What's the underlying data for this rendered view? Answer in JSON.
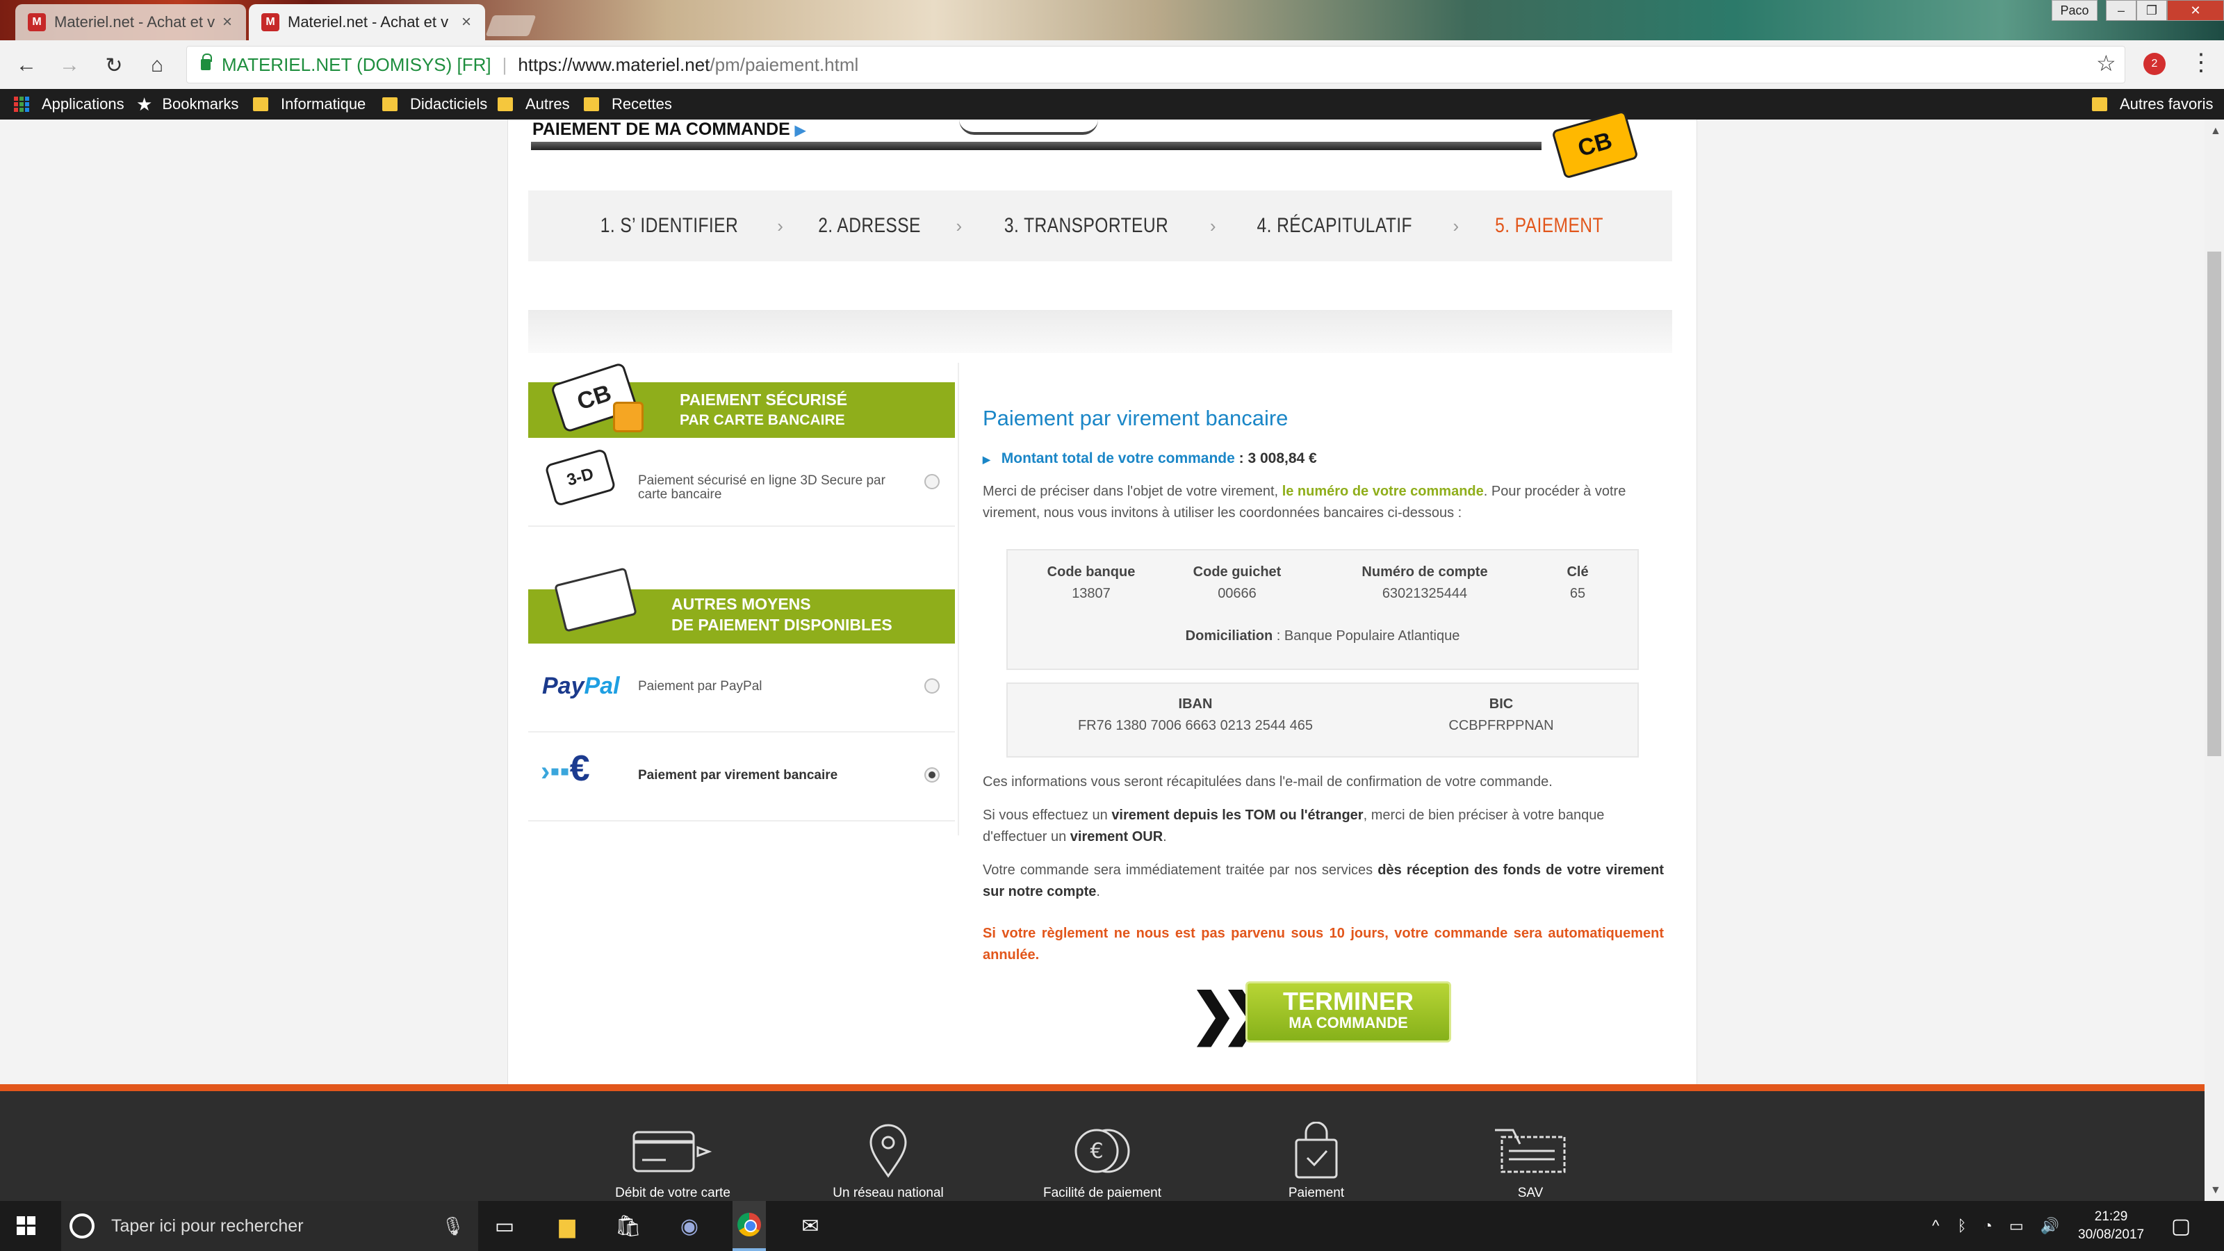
{
  "browser": {
    "tabs": [
      {
        "title": "Materiel.net - Achat et v",
        "active": false
      },
      {
        "title": "Materiel.net - Achat et v",
        "active": true
      }
    ],
    "profile": "Paco",
    "favicon": "M",
    "address": {
      "secure_label": "MATERIEL.NET (DOMISYS) [FR]",
      "separator": "|",
      "url_host": "https://www.materiel.net",
      "url_path": "/pm/paiement.html"
    },
    "extension_badge": "2",
    "bookmarks": [
      "Applications",
      "Bookmarks",
      "Informatique",
      "Didacticiels",
      "Autres",
      "Recettes"
    ],
    "other_bookmarks": "Autres favoris"
  },
  "page": {
    "header_title": "PAIEMENT DE MA COMMANDE",
    "cb_logo": "CB",
    "steps": [
      {
        "label": "1. S’ IDENTIFIER",
        "active": false
      },
      {
        "label": "2.  ADRESSE",
        "active": false
      },
      {
        "label": "3.  TRANSPORTEUR",
        "active": false
      },
      {
        "label": "4.  RÉCAPITULATIF",
        "active": false
      },
      {
        "label": "5.  PAIEMENT",
        "active": true
      }
    ],
    "step_separator": "›",
    "left": {
      "banner_card_line1": "PAIEMENT SÉCURISÉ",
      "banner_card_line2": "PAR CARTE BANCAIRE",
      "card_icon_text": "3-D",
      "card_option": "Paiement sécurisé en ligne 3D Secure par carte bancaire",
      "banner_other_line1": "AUTRES MOYENS",
      "banner_other_line2": "DE PAIEMENT DISPONIBLES",
      "paypal_logo_1": "Pay",
      "paypal_logo_2": "Pal",
      "paypal_option": "Paiement par PayPal",
      "transfer_option": "Paiement par virement bancaire",
      "selected": "transfer"
    },
    "right": {
      "title": "Paiement par virement bancaire",
      "total_label": "Montant total de votre commande",
      "total_value": " : 3 008,84 €",
      "intro_1": "Merci de préciser dans l'objet de votre virement, ",
      "intro_highlight": "le numéro de votre commande",
      "intro_2": ". Pour procéder à votre virement, nous vous invitons à utiliser les coordonnées bancaires ci-dessous :",
      "bank": {
        "headers": [
          "Code banque",
          "Code guichet",
          "Numéro de compte",
          "Clé"
        ],
        "values": [
          "13807",
          "00666",
          "63021325444",
          "65"
        ],
        "domiciliation_label": "Domiciliation",
        "domiciliation_value": " : Banque Populaire Atlantique",
        "iban_label": "IBAN",
        "iban_value": "FR76 1380 7006 6663 0213 2544 465",
        "bic_label": "BIC",
        "bic_value": "CCBPFRPPNAN"
      },
      "info_recap": "Ces informations vous seront récapitulées dans l'e-mail de confirmation de votre commande.",
      "tom_1": "Si vous effectuez un ",
      "tom_bold_1": "virement depuis les TOM ou l'étranger",
      "tom_2": ", merci de bien préciser à votre banque d'effectuer un ",
      "tom_bold_2": "virement OUR",
      "tom_3": ".",
      "process_1": "Votre commande sera immédiatement traitée par nos services ",
      "process_bold": "dès réception des fonds de votre virement sur notre compte",
      "process_2": ".",
      "warning": "Si votre règlement ne nous est pas parvenu sous 10 jours, votre commande sera automatiquement annulée.",
      "finish_line1": "TERMINER",
      "finish_line2": "MA COMMANDE"
    },
    "footer": [
      {
        "label": "Débit de votre carte",
        "icon": "card-debit-icon"
      },
      {
        "label": "Un réseau national",
        "icon": "map-pin-icon"
      },
      {
        "label": "Facilité de paiement",
        "icon": "coins-icon"
      },
      {
        "label": "Paiement",
        "icon": "secure-bag-icon"
      },
      {
        "label": "SAV",
        "icon": "service-icon"
      }
    ]
  },
  "taskbar": {
    "search_placeholder": "Taper ici pour rechercher",
    "time": "21:29",
    "date": "30/08/2017"
  },
  "colors": {
    "accent_orange": "#e2561b",
    "accent_green": "#8fae1b",
    "title_blue": "#1a86c7"
  }
}
